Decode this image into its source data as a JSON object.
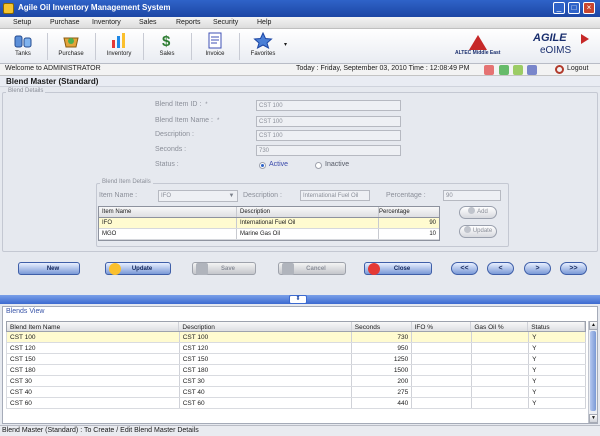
{
  "window": {
    "title": "Agile Oil Inventory Management System",
    "controls": [
      "minimize",
      "maximize",
      "close"
    ]
  },
  "menu": [
    "Setup",
    "Purchase",
    "Inventory",
    "Sales",
    "Reports",
    "Security",
    "Help"
  ],
  "toolbar": {
    "items": [
      {
        "label": "Tanks",
        "icon": "tanks-icon"
      },
      {
        "label": "Purchase",
        "icon": "purchase-icon"
      },
      {
        "label": "Inventory",
        "icon": "inventory-icon"
      },
      {
        "label": "Sales",
        "icon": "sales-icon"
      },
      {
        "label": "Invoice",
        "icon": "invoice-icon"
      },
      {
        "label": "Favorites",
        "icon": "favorites-icon"
      }
    ],
    "logos": {
      "altec": "ALTEC Middle East",
      "agile": "AGILE",
      "product": "eOIMS"
    }
  },
  "infobar": {
    "welcome": "Welcome to ADMINISTRATOR",
    "today": "Today : Friday, September 03, 2010  Time : 12:08:49 PM",
    "logout": "Logout"
  },
  "screen_title": "Blend Master (Standard)",
  "blend_details": {
    "group_title": "Blend Details",
    "fields": {
      "blend_item_id": {
        "label": "Blend Item ID :",
        "value": "CST 100"
      },
      "blend_item_name": {
        "label": "Blend Item Name :",
        "value": "CST 100"
      },
      "description": {
        "label": "Description :",
        "value": "CST 100"
      },
      "seconds": {
        "label": "Seconds :",
        "value": "730"
      }
    },
    "status": {
      "label": "Status :",
      "options": [
        "Active",
        "Inactive"
      ],
      "selected": "Active"
    }
  },
  "blend_item_details": {
    "group_title": "Blend Item Details",
    "item_name_label": "Item Name :",
    "item_name_value": "IFO",
    "description_label": "Description :",
    "description_value": "International Fuel Oil",
    "percentage_label": "Percentage :",
    "percentage_value": "90",
    "table": {
      "columns": [
        "Item Name",
        "Description",
        "Percentage"
      ],
      "rows": [
        [
          "IFO",
          "International Fuel Oil",
          "90"
        ],
        [
          "MGO",
          "Marine Gas Oil",
          "10"
        ]
      ],
      "selected_row": 0
    },
    "buttons": {
      "add": "Add",
      "update": "Update"
    }
  },
  "actions": {
    "new": "New",
    "update": "Update",
    "save": "Save",
    "cancel": "Cancel",
    "close": "Close",
    "nav": [
      "<<",
      "<",
      ">",
      ">>"
    ]
  },
  "blends_view": {
    "title": "Blends View",
    "columns": [
      "Blend Item Name",
      "Description",
      "Seconds",
      "IFO %",
      "Gas Oil %",
      "Status"
    ],
    "rows": [
      [
        "CST 100",
        "CST 100",
        "730",
        "",
        "",
        "Y"
      ],
      [
        "CST 120",
        "CST 120",
        "950",
        "",
        "",
        "Y"
      ],
      [
        "CST 150",
        "CST 150",
        "1250",
        "",
        "",
        "Y"
      ],
      [
        "CST 180",
        "CST 180",
        "1500",
        "",
        "",
        "Y"
      ],
      [
        "CST 30",
        "CST 30",
        "200",
        "",
        "",
        "Y"
      ],
      [
        "CST 40",
        "CST 40",
        "275",
        "",
        "",
        "Y"
      ],
      [
        "CST 60",
        "CST 60",
        "440",
        "",
        "",
        "Y"
      ]
    ],
    "selected_row": 0
  },
  "status_text": "Blend Master (Standard) : To Create / Edit Blend Master Details",
  "colors": {
    "title_bar": "#1c46a4",
    "selection": "#fffbd0",
    "splitter": "#3c6ad0",
    "brand_red": "#c62828"
  }
}
